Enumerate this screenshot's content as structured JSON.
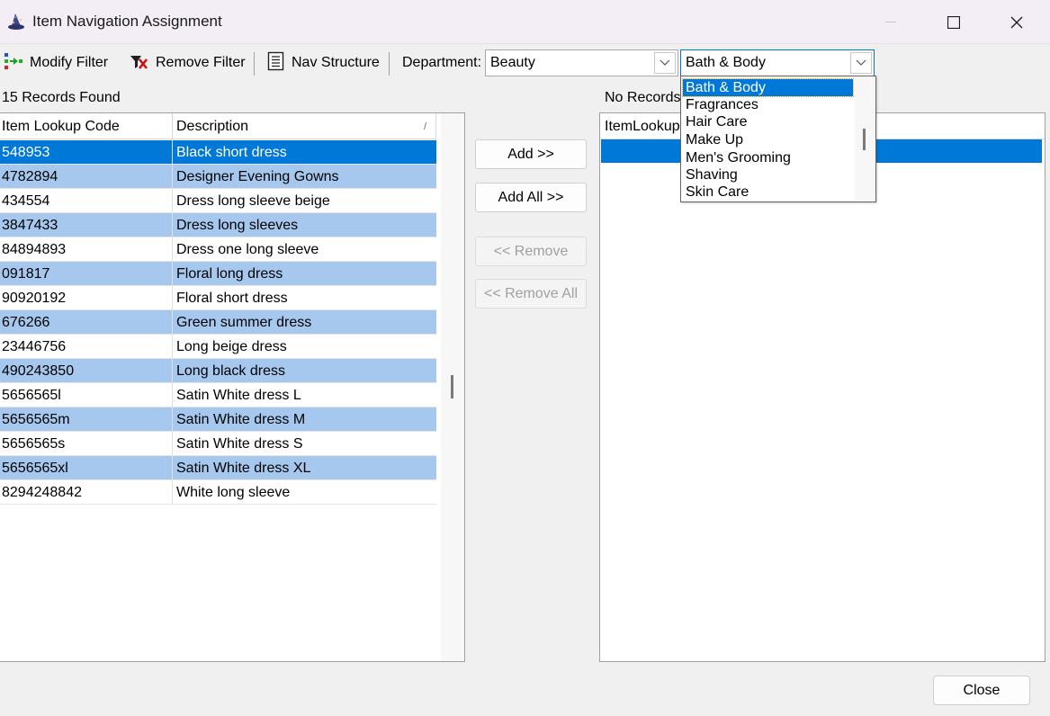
{
  "window": {
    "title": "Item Navigation Assignment"
  },
  "toolbar": {
    "modify_filter": "Modify Filter",
    "remove_filter": "Remove Filter",
    "nav_structure": "Nav Structure",
    "department_label": "Department:",
    "department_value": "Beauty",
    "category_value": "Bath & Body"
  },
  "left_panel": {
    "records_label": "15 Records Found",
    "columns": [
      "Item Lookup Code",
      "Description"
    ],
    "sort_indicator": "/",
    "rows": [
      {
        "code": "548953",
        "desc": "Black short dress"
      },
      {
        "code": "4782894",
        "desc": "Designer Evening Gowns"
      },
      {
        "code": "434554",
        "desc": "Dress long sleeve beige"
      },
      {
        "code": "3847433",
        "desc": "Dress long sleeves"
      },
      {
        "code": "84894893",
        "desc": "Dress one long sleeve"
      },
      {
        "code": "091817",
        "desc": "Floral long dress"
      },
      {
        "code": "90920192",
        "desc": "Floral short dress"
      },
      {
        "code": "676266",
        "desc": "Green summer dress"
      },
      {
        "code": "23446756",
        "desc": "Long beige dress"
      },
      {
        "code": "490243850",
        "desc": "Long black dress"
      },
      {
        "code": "5656565l",
        "desc": "Satin White dress L"
      },
      {
        "code": "5656565m",
        "desc": "Satin White dress M"
      },
      {
        "code": "5656565s",
        "desc": "Satin White dress S"
      },
      {
        "code": "5656565xl",
        "desc": "Satin White dress XL"
      },
      {
        "code": "8294248842",
        "desc": "White long sleeve"
      }
    ]
  },
  "middle_buttons": {
    "add": "Add >>",
    "add_all": "Add All >>",
    "remove": "<< Remove",
    "remove_all": "<< Remove All"
  },
  "right_panel": {
    "records_label": "No Records",
    "column_header": "ItemLookup"
  },
  "dropdown": {
    "items": [
      "Bath & Body",
      "Fragrances",
      "Hair Care",
      "Make Up",
      "Men's Grooming",
      "Shaving",
      "Skin Care"
    ]
  },
  "footer": {
    "close": "Close"
  },
  "colors": {
    "selection": "#0078d7",
    "alt_row": "#a6c8ee"
  }
}
